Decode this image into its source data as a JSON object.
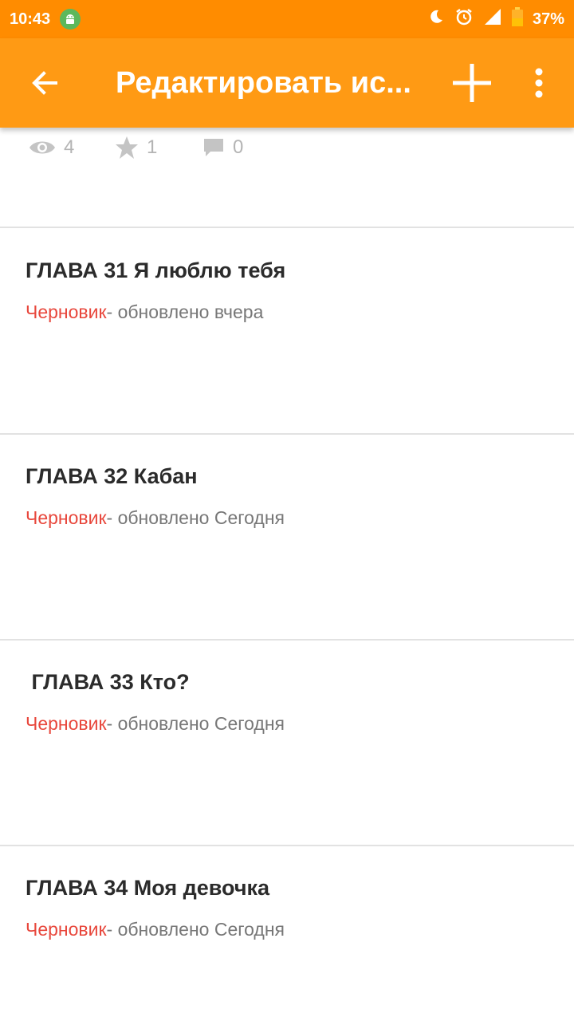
{
  "status_bar": {
    "time": "10:43",
    "battery": "37%",
    "icons": [
      "android-icon",
      "moon-icon",
      "alarm-icon",
      "signal-icon",
      "battery-icon"
    ]
  },
  "app_bar": {
    "title": "Редактировать ис...",
    "color": "#ff9a14",
    "icons": [
      "back-arrow-icon",
      "add-icon",
      "more-vert-icon"
    ]
  },
  "stats": {
    "views": "4",
    "votes": "1",
    "comments": "0"
  },
  "parts": [
    {
      "title": "ГЛАВА 31 Я люблю тебя",
      "status": "Черновик",
      "updated": "- обновлено вчера"
    },
    {
      "title": "ГЛАВА 32 Кабан",
      "status": "Черновик",
      "updated": "- обновлено Сегодня"
    },
    {
      "title": " ГЛАВА 33 Кто?",
      "status": "Черновик",
      "updated": "- обновлено Сегодня"
    },
    {
      "title": "ГЛАВА 34 Моя девочка",
      "status": "Черновик",
      "updated": "- обновлено Сегодня"
    }
  ],
  "colors": {
    "status_bar": "#ff8c00",
    "draft": "#e8473c"
  }
}
